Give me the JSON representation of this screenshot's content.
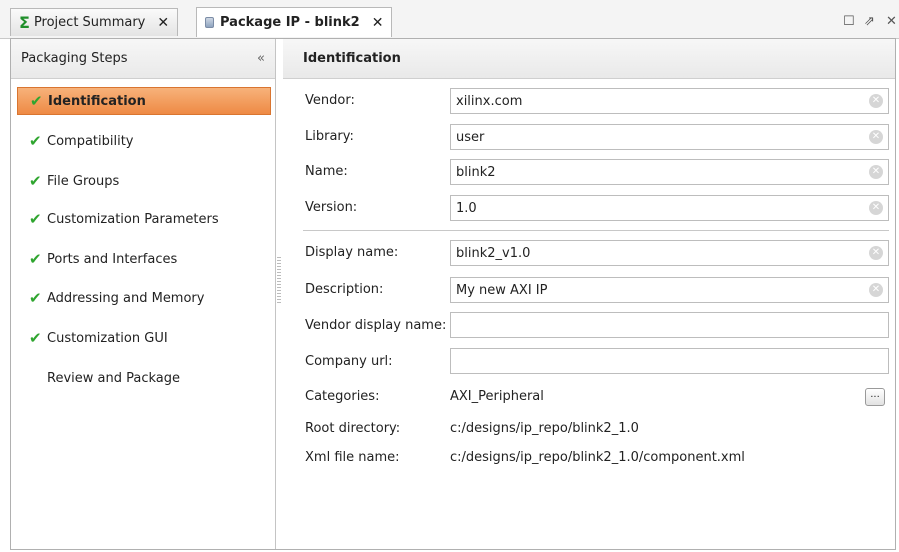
{
  "tabs": [
    {
      "label": "Project Summary",
      "icon": "sigma-icon"
    },
    {
      "label": "Package IP - blink2",
      "icon": "package-icon"
    }
  ],
  "window_controls": {
    "restore": "☐",
    "popout": "⇗",
    "close": "✕"
  },
  "left_panel": {
    "title": "Packaging Steps",
    "collapse_glyph": "«",
    "steps": [
      {
        "label": "Identification",
        "done": true
      },
      {
        "label": "Compatibility",
        "done": true
      },
      {
        "label": "File Groups",
        "done": true
      },
      {
        "label": "Customization Parameters",
        "done": true
      },
      {
        "label": "Ports and Interfaces",
        "done": true
      },
      {
        "label": "Addressing and Memory",
        "done": true
      },
      {
        "label": "Customization GUI",
        "done": true
      },
      {
        "label": "Review and Package",
        "done": false
      }
    ],
    "selected_step": "Identification"
  },
  "right_panel": {
    "title": "Identification",
    "fields": {
      "vendor": {
        "label": "Vendor:",
        "value": "xilinx.com"
      },
      "library": {
        "label": "Library:",
        "value": "user"
      },
      "name": {
        "label": "Name:",
        "value": "blink2"
      },
      "version": {
        "label": "Version:",
        "value": "1.0"
      },
      "display_name": {
        "label": "Display name:",
        "value": "blink2_v1.0"
      },
      "description": {
        "label": "Description:",
        "value": "My new AXI IP"
      },
      "vendor_display_name": {
        "label": "Vendor display name:",
        "value": ""
      },
      "company_url": {
        "label": "Company url:",
        "value": ""
      }
    },
    "categories": {
      "label": "Categories:",
      "value": "AXI_Peripheral",
      "button": "..."
    },
    "root_directory": {
      "label": "Root directory:",
      "value": "c:/designs/ip_repo/blink2_1.0"
    },
    "xml_file_name": {
      "label": "Xml file name:",
      "value": "c:/designs/ip_repo/blink2_1.0/component.xml"
    }
  },
  "colors": {
    "selected_step": "#ee8a45",
    "check": "#2fa52f",
    "sigma": "#1f8f2a"
  }
}
